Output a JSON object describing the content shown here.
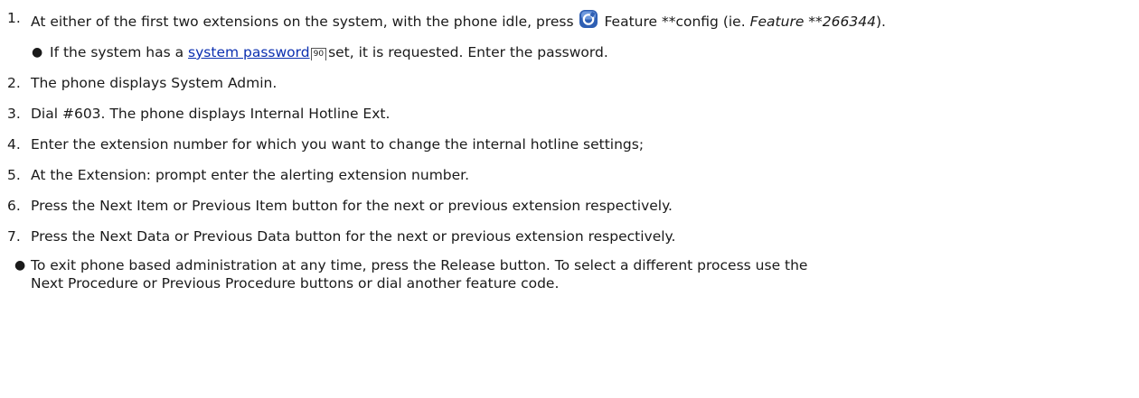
{
  "steps": [
    {
      "number": "1.",
      "pre": "At either of the first two extensions on the system, with the phone idle, press",
      "icon": "feature-button-icon",
      "post": "Feature **config (ie.",
      "example": "Feature **266344",
      "end": ")."
    },
    {
      "sub_pre": "If the system has a",
      "sub_link": "system password",
      "sub_ref": "90",
      "sub_post": "set, it is requested. Enter the password."
    },
    {
      "number": "2.",
      "text": "The phone displays System Admin."
    },
    {
      "number": "3.",
      "text": "Dial #603. The phone displays Internal Hotline Ext."
    },
    {
      "number": "4.",
      "text": "Enter the extension number for which you want to change the internal hotline settings;"
    },
    {
      "number": "5.",
      "text": "At the Extension: prompt enter the alerting extension number."
    },
    {
      "number": "6.",
      "text": "Press the Next Item or Previous Item button for the next or previous extension respectively."
    },
    {
      "number": "7.",
      "text": "Press the Next Data or Previous Data button for the next or previous extension respectively."
    }
  ],
  "note": {
    "line1": "To exit phone based administration at any time, press the Release button. To select a different process use the",
    "line2": "Next Procedure or Previous Procedure buttons or dial another feature code."
  },
  "colors": {
    "link": "#0b2fb0",
    "icon_body": "#2f5fb3"
  }
}
